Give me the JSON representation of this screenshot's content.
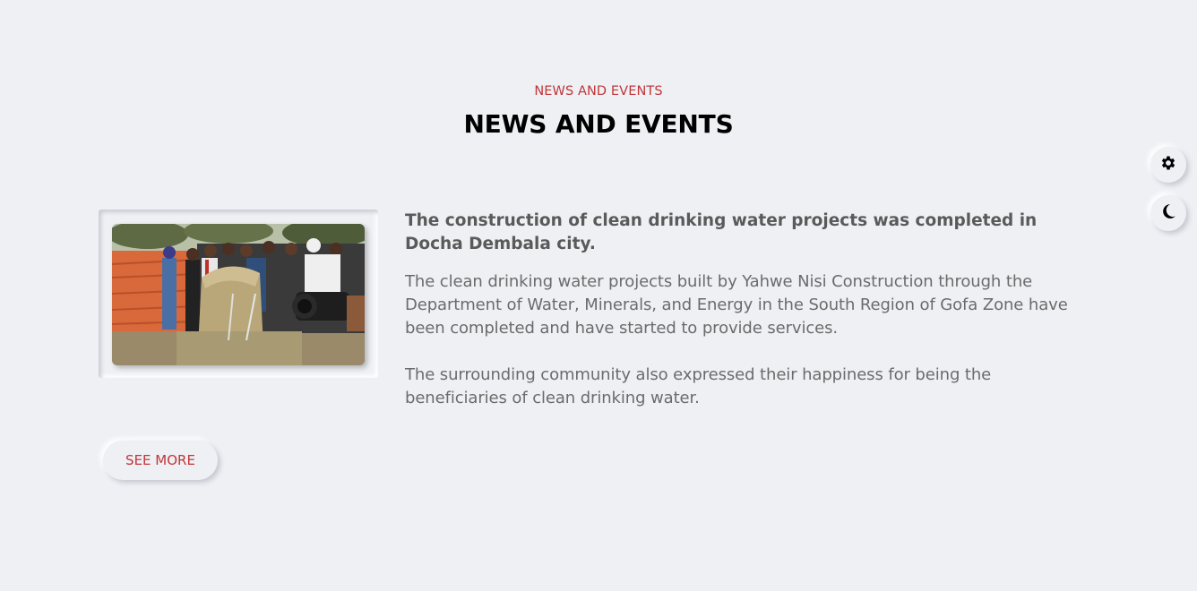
{
  "section": {
    "kicker": "NEWS AND EVENTS",
    "title": "NEWS AND EVENTS"
  },
  "news_item": {
    "headline": "The construction of clean drinking water projects was completed in Docha Dembala city.",
    "paragraphs": [
      "The clean drinking water projects built by Yahwe Nisi Construction through the Department of Water, Minerals, and Energy in the South Region of Gofa Zone have been completed and have started to provide services.",
      "The surrounding community also expressed their happiness for being the beneficiaries of clean drinking water."
    ]
  },
  "see_more_label": "SEE MORE",
  "floating_controls": {
    "settings_icon": "gear-icon",
    "theme_icon": "moon-icon"
  },
  "colors": {
    "background": "#eef0f4",
    "accent": "#c0363a",
    "heading": "#000000",
    "body_text": "#6b6b6b"
  }
}
